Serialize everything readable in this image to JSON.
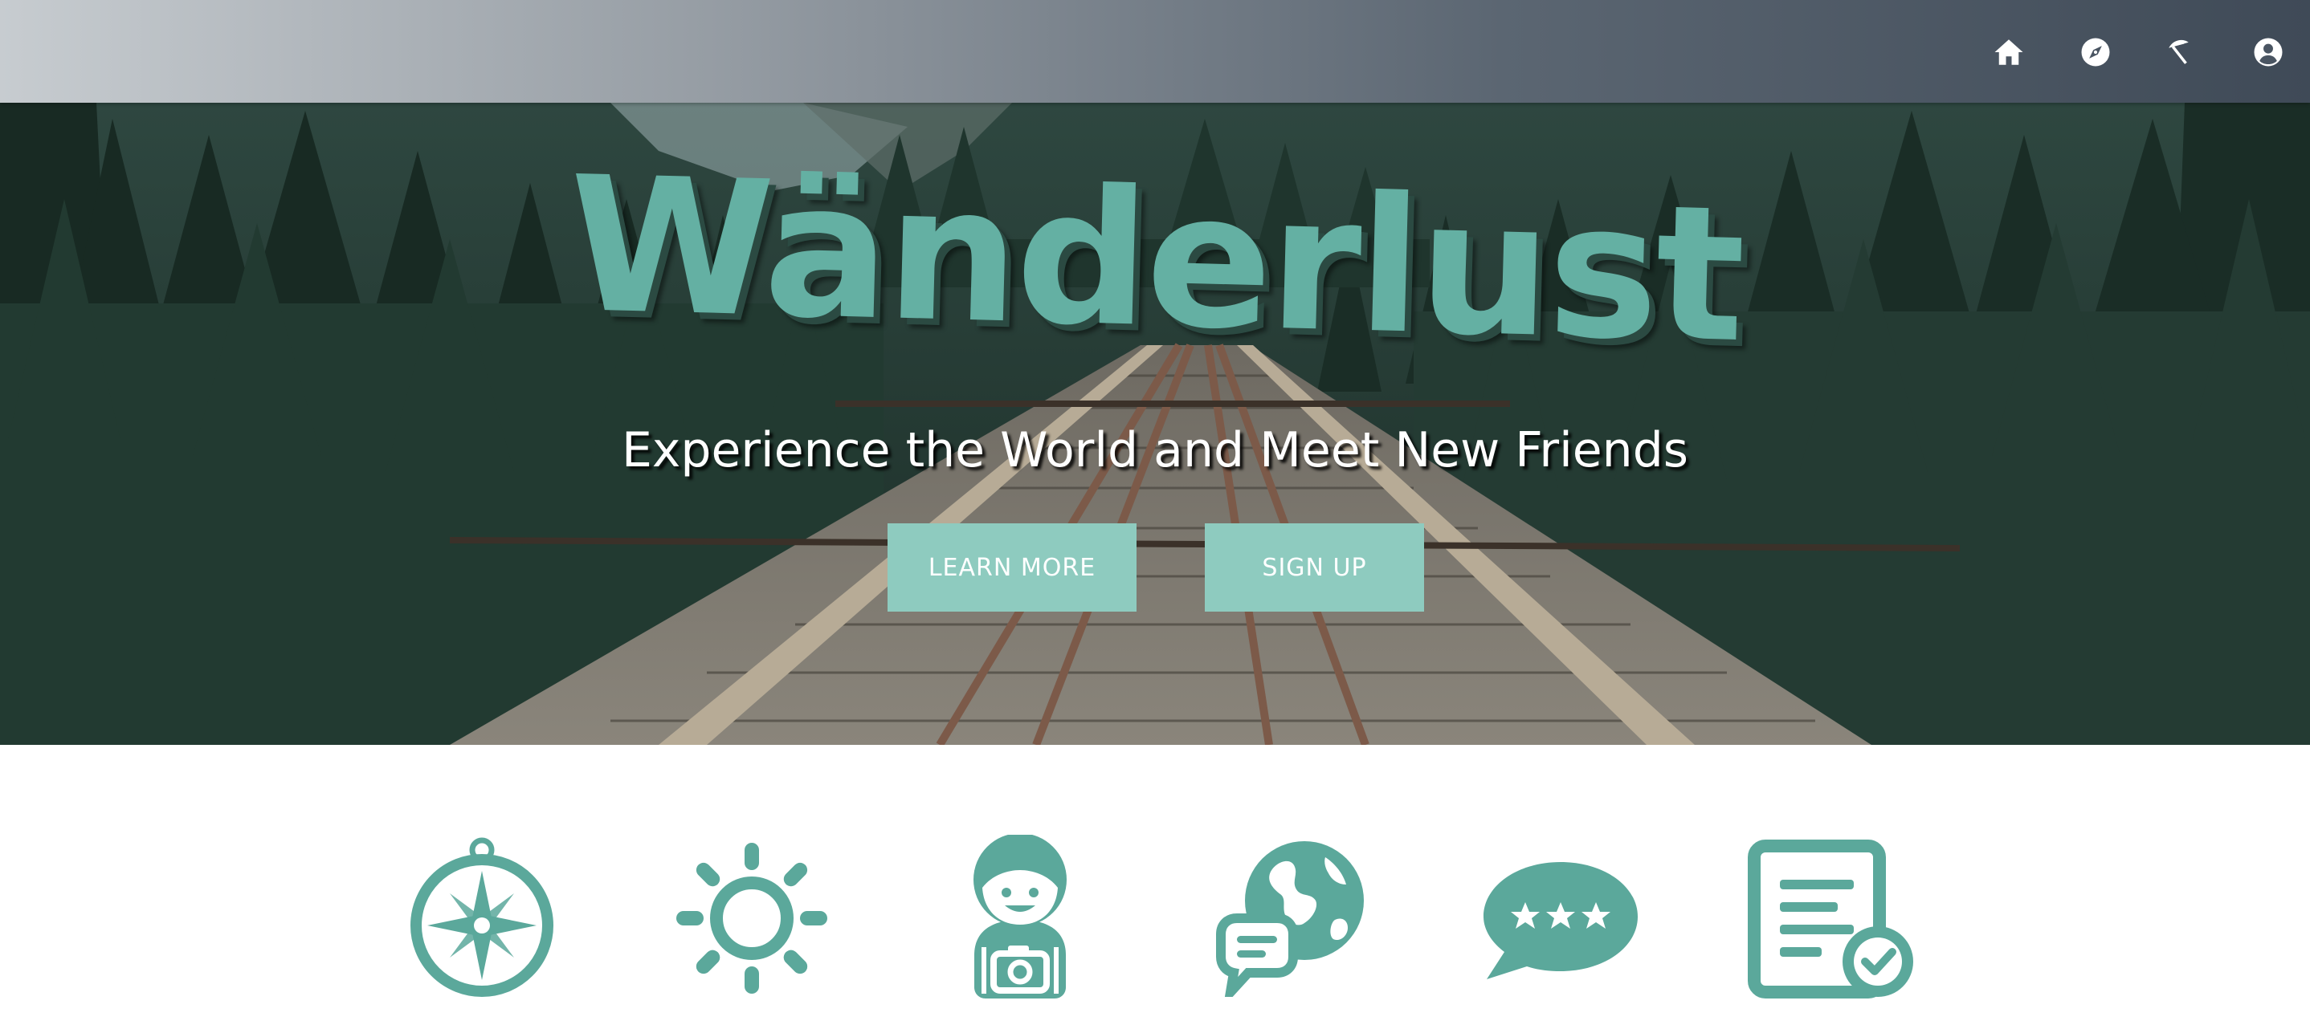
{
  "nav": {
    "items": [
      {
        "icon": "home-icon"
      },
      {
        "icon": "compass-icon"
      },
      {
        "icon": "beach-umbrella-icon"
      },
      {
        "icon": "account-icon"
      }
    ]
  },
  "hero": {
    "title": "Wänderlust",
    "subtitle": "Experience the World and Meet New Friends",
    "learn_more_label": "LEARN MORE",
    "sign_up_label": "SIGN UP"
  },
  "features": [
    {
      "icon": "compass-feature-icon"
    },
    {
      "icon": "sun-feature-icon"
    },
    {
      "icon": "traveler-camera-feature-icon"
    },
    {
      "icon": "globe-chat-feature-icon"
    },
    {
      "icon": "rating-speech-bubble-icon"
    },
    {
      "icon": "checklist-document-icon"
    }
  ],
  "colors": {
    "accent": "#5ba89b",
    "button": "#8ecbbf",
    "title": "#64b0a3",
    "topbar_start": "#c7ccd0",
    "topbar_end": "#3f4a57"
  }
}
